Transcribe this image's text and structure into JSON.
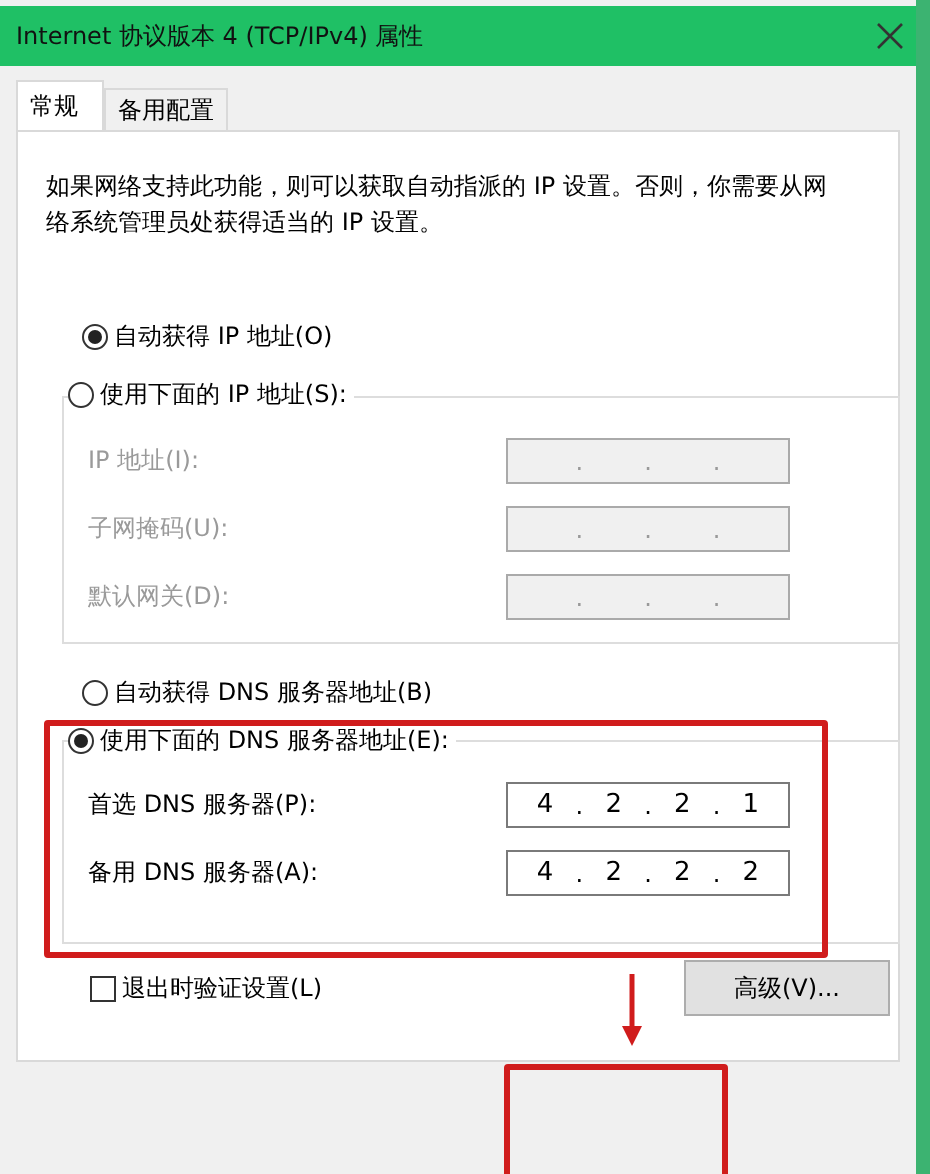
{
  "window": {
    "title": "Internet 协议版本 4 (TCP/IPv4) 属性"
  },
  "tabs": [
    {
      "label": "常规",
      "selected": true
    },
    {
      "label": "备用配置",
      "selected": false
    }
  ],
  "description": "如果网络支持此功能，则可以获取自动指派的 IP 设置。否则，你需要从网络系统管理员处获得适当的 IP 设置。",
  "ip_separator": ".",
  "ip_section": {
    "auto_option": {
      "label": "自动获得 IP 地址(O)",
      "selected": true
    },
    "manual_option": {
      "label": "使用下面的 IP 地址(S):",
      "selected": false
    },
    "fields": [
      {
        "label": "IP 地址(I):",
        "disabled": true
      },
      {
        "label": "子网掩码(U):",
        "disabled": true
      },
      {
        "label": "默认网关(D):",
        "disabled": true
      }
    ]
  },
  "dns_section": {
    "auto_option": {
      "label": "自动获得 DNS 服务器地址(B)",
      "selected": false
    },
    "manual_option": {
      "label": "使用下面的 DNS 服务器地址(E):",
      "selected": true
    },
    "fields": [
      {
        "label": "首选 DNS 服务器(P):",
        "disabled": false,
        "octets": [
          "4",
          "2",
          "2",
          "1"
        ]
      },
      {
        "label": "备用 DNS 服务器(A):",
        "disabled": false,
        "octets": [
          "4",
          "2",
          "2",
          "2"
        ]
      }
    ]
  },
  "validate_checkbox": {
    "label": "退出时验证设置(L)",
    "checked": false
  },
  "advanced_button": "高级(V)...",
  "annotations": [
    {
      "kind": "highlight_box"
    },
    {
      "kind": "arrow"
    },
    {
      "kind": "highlight_box"
    }
  ]
}
